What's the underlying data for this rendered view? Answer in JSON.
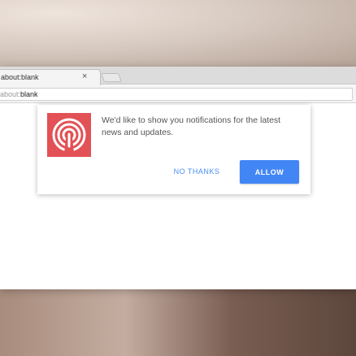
{
  "browser": {
    "tab": {
      "title": "about:blank",
      "close_glyph": "×"
    },
    "address_bar": {
      "prefix": "about:",
      "host": "blank"
    }
  },
  "notification_prompt": {
    "icon": "broadcast-signal-icon",
    "message": "We'd like to show you notifications for the latest news and updates.",
    "no_thanks_label": "NO THANKS",
    "allow_label": "ALLOW"
  },
  "colors": {
    "allow_button": "#4286f5",
    "no_thanks_text": "#4a8ef0",
    "logo_background": "#e25155"
  }
}
